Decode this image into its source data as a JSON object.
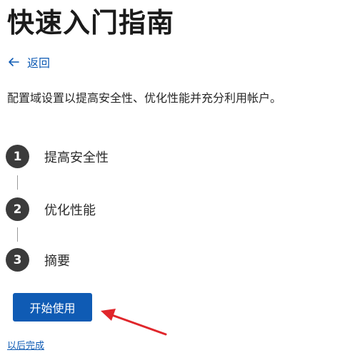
{
  "header": {
    "title": "快速入门指南"
  },
  "nav": {
    "back_label": "返回",
    "back_icon": "arrow-left-icon"
  },
  "description": "配置域设置以提高安全性、优化性能并充分利用帐户。",
  "steps": [
    {
      "number": "1",
      "label": "提高安全性"
    },
    {
      "number": "2",
      "label": "优化性能"
    },
    {
      "number": "3",
      "label": "摘要"
    }
  ],
  "actions": {
    "start_label": "开始使用",
    "later_label": "以后完成"
  },
  "colors": {
    "accent": "#0f5bb4",
    "step_circle": "#3b3b3b",
    "annotation_arrow": "#e0262b"
  }
}
